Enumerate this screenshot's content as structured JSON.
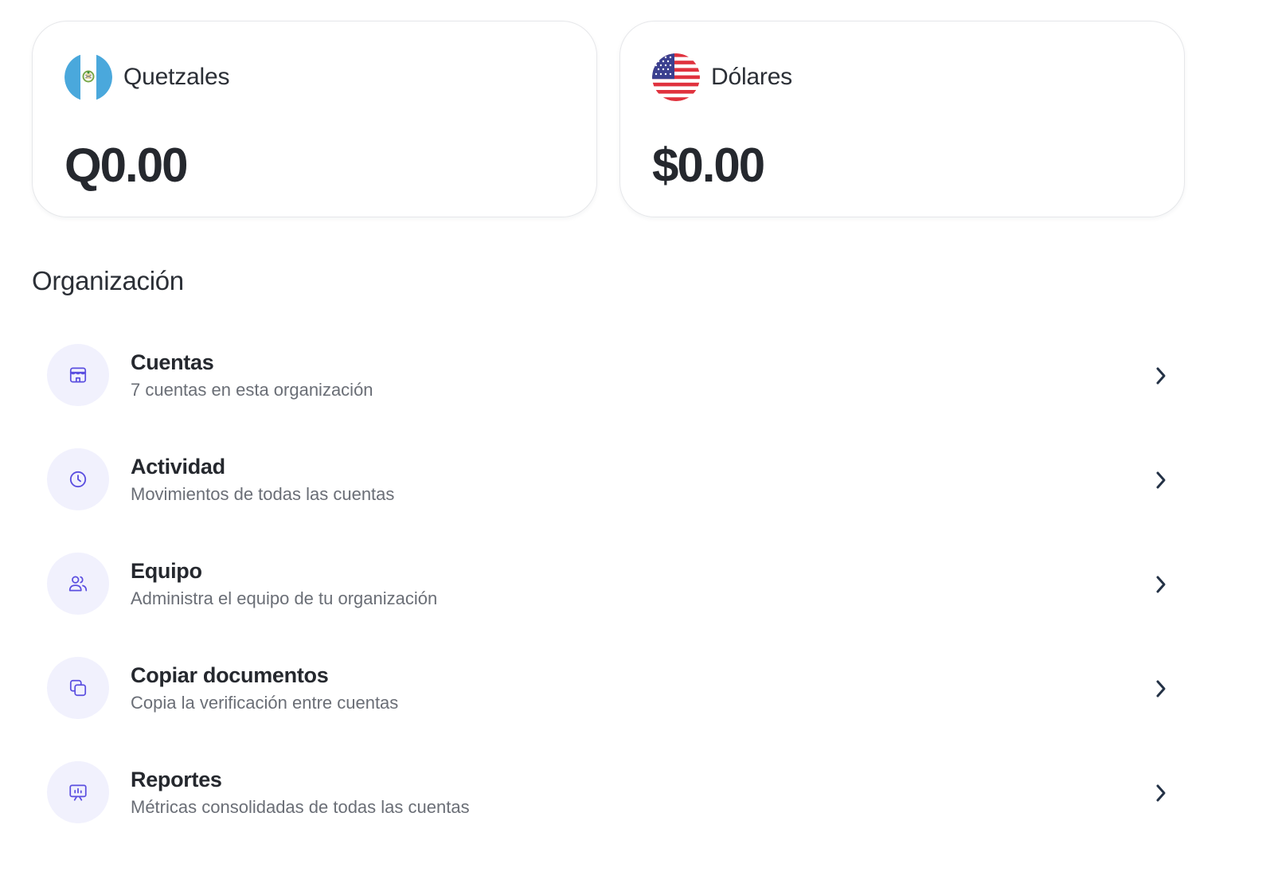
{
  "balances": [
    {
      "currency": "Quetzales",
      "amount": "Q0.00",
      "flag_icon": "guatemala-flag-icon"
    },
    {
      "currency": "Dólares",
      "amount": "$0.00",
      "flag_icon": "usa-flag-icon"
    }
  ],
  "section": {
    "title": "Organización"
  },
  "menu": [
    {
      "title": "Cuentas",
      "subtitle": "7 cuentas en esta organización",
      "icon": "store-icon"
    },
    {
      "title": "Actividad",
      "subtitle": "Movimientos de todas las cuentas",
      "icon": "clock-icon"
    },
    {
      "title": "Equipo",
      "subtitle": "Administra el equipo de tu organización",
      "icon": "users-icon"
    },
    {
      "title": "Copiar documentos",
      "subtitle": "Copia la verificación entre cuentas",
      "icon": "copy-icon"
    },
    {
      "title": "Reportes",
      "subtitle": "Métricas consolidadas de todas las cuentas",
      "icon": "presentation-chart-icon"
    }
  ],
  "colors": {
    "accent": "#5b4fe0",
    "icon_bg": "#f1f1fd",
    "chevron": "#243246",
    "card_border": "#e6e7ea"
  }
}
